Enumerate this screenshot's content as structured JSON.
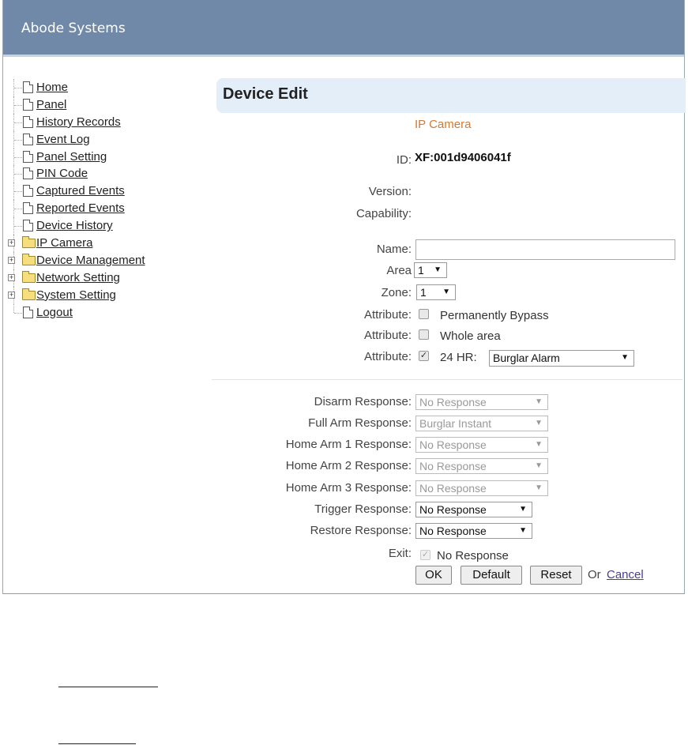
{
  "app": {
    "title": "Abode Systems"
  },
  "sidebar": {
    "items": [
      {
        "label": "Home",
        "type": "doc"
      },
      {
        "label": "Panel",
        "type": "doc"
      },
      {
        "label": "History Records",
        "type": "doc"
      },
      {
        "label": "Event Log",
        "type": "doc"
      },
      {
        "label": "Panel Setting",
        "type": "doc"
      },
      {
        "label": "PIN Code",
        "type": "doc"
      },
      {
        "label": "Captured Events",
        "type": "doc"
      },
      {
        "label": "Reported Events",
        "type": "doc"
      },
      {
        "label": "Device History",
        "type": "doc"
      },
      {
        "label": "IP Camera",
        "type": "folder"
      },
      {
        "label": "Device Management",
        "type": "folder"
      },
      {
        "label": "Network Setting",
        "type": "folder"
      },
      {
        "label": "System Setting",
        "type": "folder"
      },
      {
        "label": "Logout",
        "type": "doc"
      }
    ]
  },
  "main": {
    "title": "Device Edit",
    "device_type": "IP Camera",
    "device_type_color": "#d07a34",
    "id_label": "ID:",
    "id_value": "XF:001d9406041f",
    "version_label": "Version:",
    "capability_label": "Capability:",
    "name_label": "Name:",
    "name_value": "",
    "area_label": "Area",
    "area_value": "1",
    "zone_label": "Zone:",
    "zone_value": "1",
    "attributes": [
      {
        "label": "Attribute:",
        "text": "Permanently Bypass",
        "checked": false
      },
      {
        "label": "Attribute:",
        "text": "Whole area",
        "checked": false
      },
      {
        "label": "Attribute:",
        "text": "24 HR:",
        "checked": true,
        "select": "Burglar Alarm"
      }
    ],
    "responses": [
      {
        "label": "Disarm Response:",
        "value": "No Response",
        "disabled": true
      },
      {
        "label": "Full Arm Response:",
        "value": "Burglar Instant",
        "disabled": true
      },
      {
        "label": "Home Arm 1 Response:",
        "value": "No Response",
        "disabled": true
      },
      {
        "label": "Home Arm 2 Response:",
        "value": "No Response",
        "disabled": true
      },
      {
        "label": "Home Arm 3 Response:",
        "value": "No Response",
        "disabled": true
      },
      {
        "label": "Trigger Response:",
        "value": "No Response",
        "disabled": false
      },
      {
        "label": "Restore Response:",
        "value": "No Response",
        "disabled": false
      }
    ],
    "exit_label": "Exit:",
    "exit_text": "No Response",
    "ok_label": "OK",
    "default_label": "Default",
    "reset_label": "Reset",
    "or_text": "Or",
    "cancel_label": "Cancel"
  }
}
